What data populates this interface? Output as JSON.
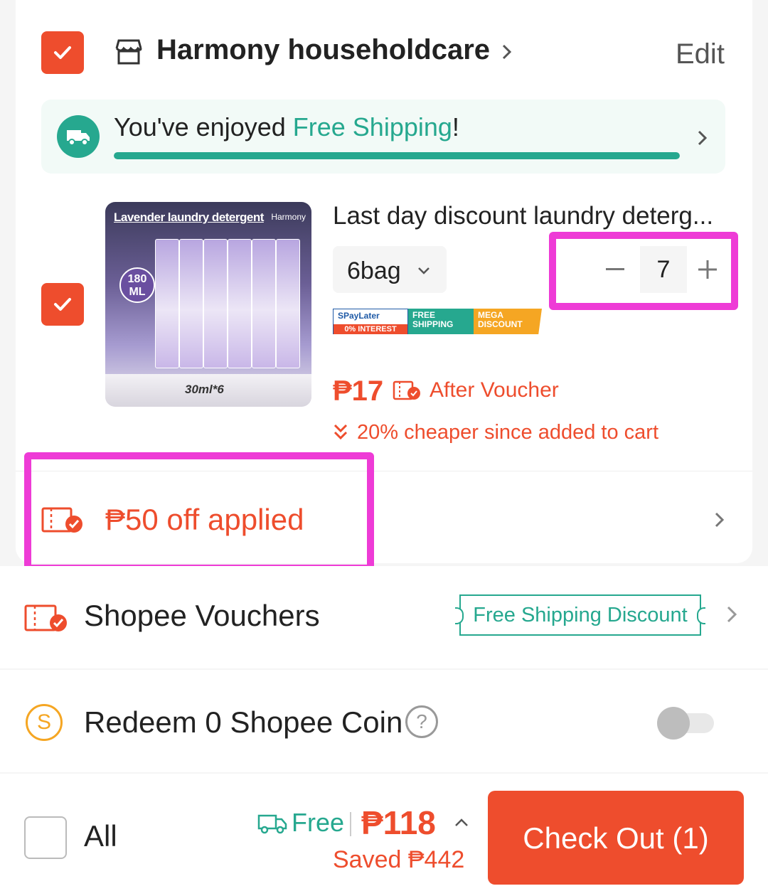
{
  "shop": {
    "name": "Harmony householdcare",
    "edit_label": "Edit"
  },
  "shipping_banner": {
    "prefix": "You've enjoyed ",
    "highlight": "Free Shipping",
    "suffix": "!",
    "progress_percent": 100
  },
  "product": {
    "title": "Last day discount laundry deterg...",
    "image_title": "Lavender laundry detergent",
    "image_brand": "Harmony",
    "image_badge": "180 ML",
    "image_caption": "30ml*6",
    "variant": "6bag",
    "quantity": "7",
    "badges": {
      "spaylater": "SPayLater",
      "spaylater_sub": "0% INTEREST",
      "free_shipping": "FREE SHIPPING",
      "mega_discount": "MEGA DISCOUNT"
    },
    "price": "₱17",
    "after_voucher": "After Voucher",
    "cheaper_text": "20% cheaper since added to cart"
  },
  "shop_voucher": {
    "text": "₱50 off applied"
  },
  "shopee_vouchers": {
    "label": "Shopee Vouchers",
    "tag": "Free Shipping Discount"
  },
  "coins": {
    "icon_letter": "S",
    "label": "Redeem 0 Shopee Coin",
    "help": "?",
    "enabled": false
  },
  "bottom_bar": {
    "all_label": "All",
    "free_label": "Free",
    "total": "₱118",
    "saved": "Saved ₱442",
    "checkout_label": "Check Out (1)"
  },
  "colors": {
    "brand": "#ee4d2d",
    "shipping_green": "#26a88f",
    "highlight": "#ee3bd6"
  }
}
